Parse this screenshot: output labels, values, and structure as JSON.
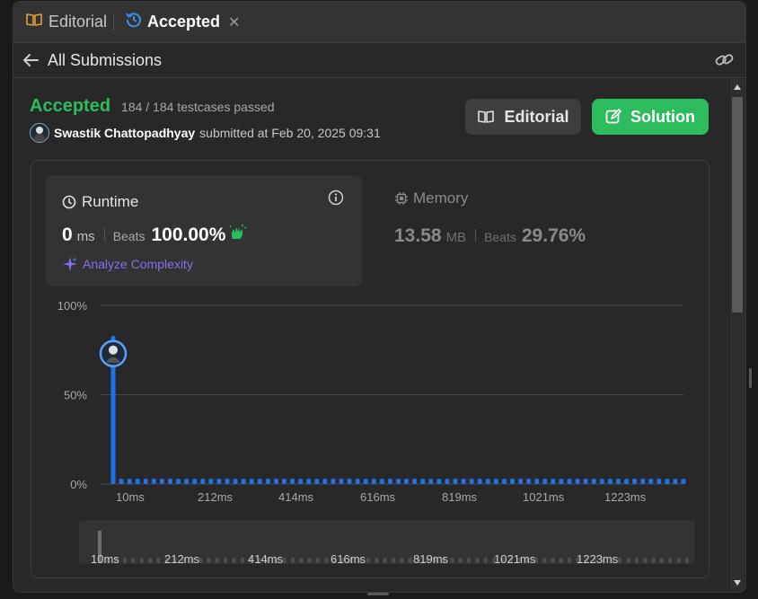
{
  "tabs": [
    {
      "label": "Editorial",
      "icon": "book-icon",
      "active": false
    },
    {
      "label": "Accepted",
      "icon": "history-icon",
      "active": true,
      "close": "✕"
    }
  ],
  "nav": {
    "back_label": "All Submissions"
  },
  "submission": {
    "status": "Accepted",
    "testcases": "184 / 184 testcases passed",
    "user": "Swastik Chattopadhyay",
    "submitted_text": "submitted at Feb 20, 2025 09:31"
  },
  "buttons": {
    "editorial": "Editorial",
    "solution": "Solution"
  },
  "runtime": {
    "title": "Runtime",
    "value": "0",
    "unit": "ms",
    "beats_label": "Beats",
    "beats_value": "100.00%",
    "analyze_label": "Analyze Complexity"
  },
  "memory": {
    "title": "Memory",
    "value": "13.58",
    "unit": "MB",
    "beats_label": "Beats",
    "beats_value": "29.76%"
  },
  "colors": {
    "accent_green": "#2cbb5d",
    "bar_blue": "#1a73e8",
    "analyze_purple": "#8b6cf0",
    "bg": "#282828"
  },
  "chart_data": {
    "type": "bar",
    "y_ticks": [
      "100%",
      "50%",
      "0%"
    ],
    "ylim": [
      0,
      100
    ],
    "x_ticks": [
      "10ms",
      "212ms",
      "414ms",
      "616ms",
      "819ms",
      "1021ms",
      "1223ms"
    ],
    "series": [
      {
        "values": [
          83,
          3,
          3,
          3,
          3,
          3,
          3,
          3,
          3,
          3,
          3,
          3,
          3,
          3,
          3,
          3,
          3,
          3,
          3,
          3,
          3,
          3,
          3,
          3,
          3,
          3,
          3,
          3,
          3,
          3,
          3,
          3,
          3,
          3,
          3,
          3,
          3,
          3,
          3,
          3,
          3,
          3,
          3,
          3,
          3,
          3,
          3,
          3,
          3,
          3,
          3,
          3,
          3,
          3,
          3,
          3,
          3,
          3,
          3,
          3,
          3,
          3,
          3,
          3,
          3,
          3,
          3,
          3,
          3,
          3,
          3
        ]
      }
    ],
    "highlight_index": 0,
    "highlight_value": 73,
    "grid": true,
    "minimap_x_ticks": [
      "10ms",
      "212ms",
      "414ms",
      "616ms",
      "819ms",
      "1021ms",
      "1223ms"
    ]
  }
}
